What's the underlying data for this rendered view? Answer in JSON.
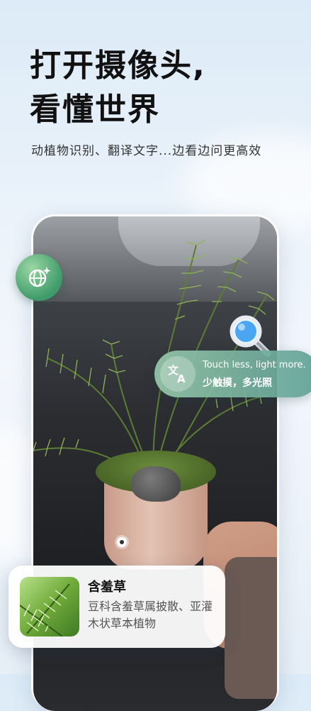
{
  "headline": {
    "line1": "打开摄像头,",
    "line2": "看懂世界"
  },
  "subtitle": "动植物识别、翻译文字...边看边问更高效",
  "translate": {
    "english": "Touch less, light more.",
    "chinese": "少触摸，多光照"
  },
  "result_card": {
    "title": "含羞草",
    "description": "豆科含羞草属披散、亚灌木状草本植物"
  },
  "icons": {
    "globe_sparkle": "globe-sparkle-icon",
    "search": "search-icon",
    "translate": "translate-icon"
  },
  "colors": {
    "accent_green": "#3f9b6a",
    "pill_teal": "#5fa096",
    "search_blue": "#2f8fe0"
  }
}
